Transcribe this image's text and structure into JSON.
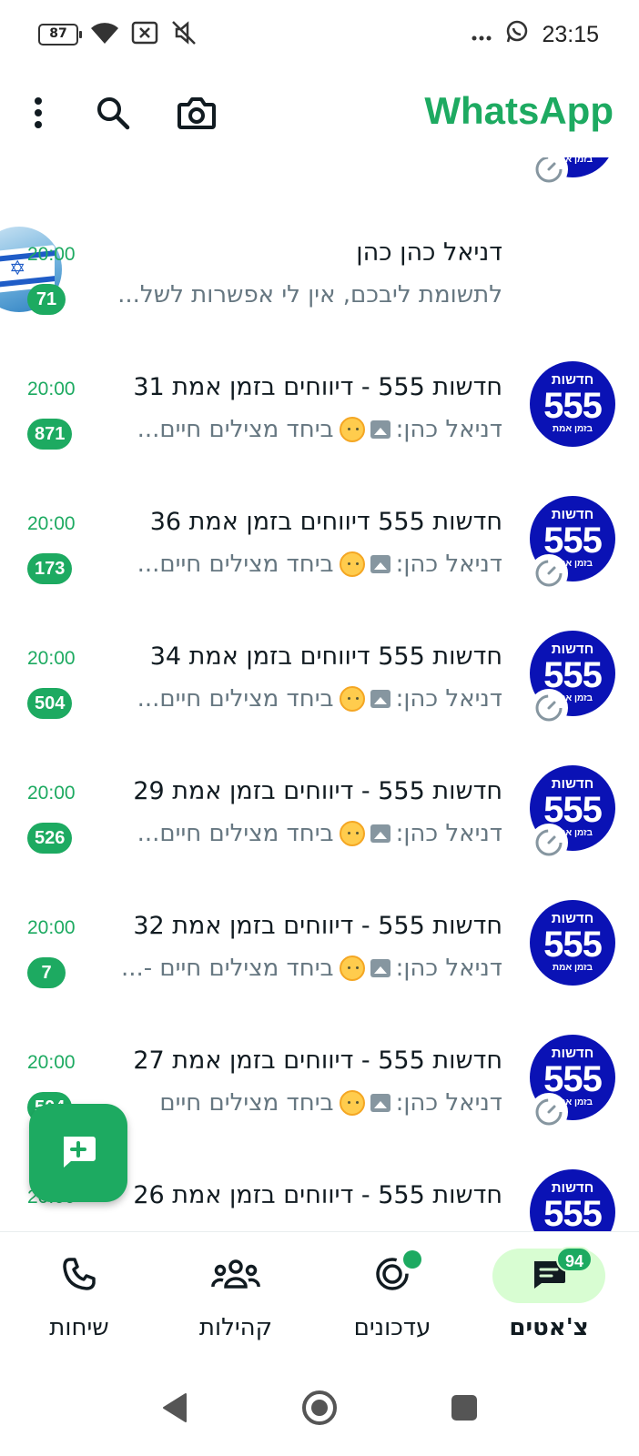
{
  "status_bar": {
    "battery": "87",
    "time": "23:15",
    "icons": [
      "battery-icon",
      "wifi-icon",
      "no-sim-icon",
      "mute-icon",
      "more-dots-icon",
      "whatsapp-notification-icon"
    ]
  },
  "app_bar": {
    "title": "WhatsApp",
    "icons": [
      "more-vert-icon",
      "search-icon",
      "camera-icon"
    ]
  },
  "chats": [
    {
      "name": "דניאל כהן כהן",
      "time": "20:00",
      "preview": "לתשומת ליבכם, אין  לי אפשרות לשל...",
      "unread": "71",
      "avatar": "flag",
      "has_image": false,
      "has_timer": false
    },
    {
      "name": "חדשות 555 - דיווחים בזמן אמת 31",
      "time": "20:00",
      "sender": "דניאל כהן:",
      "preview": "ביחד מצילים חיים...",
      "unread": "871",
      "avatar": "555",
      "has_image": true,
      "has_timer": false
    },
    {
      "name": "חדשות 555 דיווחים בזמן אמת 36",
      "time": "20:00",
      "sender": "דניאל כהן:",
      "preview": "ביחד מצילים חיים...",
      "unread": "173",
      "avatar": "555",
      "has_image": true,
      "has_timer": true
    },
    {
      "name": "חדשות 555 דיווחים בזמן אמת 34",
      "time": "20:00",
      "sender": "דניאל כהן:",
      "preview": "ביחד מצילים חיים...",
      "unread": "504",
      "avatar": "555",
      "has_image": true,
      "has_timer": true
    },
    {
      "name": "חדשות 555 - דיווחים בזמן אמת 29",
      "time": "20:00",
      "sender": "דניאל כהן:",
      "preview": "ביחד מצילים חיים...",
      "unread": "526",
      "avatar": "555",
      "has_image": true,
      "has_timer": true
    },
    {
      "name": "חדשות 555 - דיווחים בזמן אמת 32",
      "time": "20:00",
      "sender": "דניאל כהן:",
      "preview": "ביחד מצילים חיים -...",
      "unread": "7",
      "avatar": "555",
      "has_image": true,
      "has_timer": false
    },
    {
      "name": "חדשות 555 - דיווחים בזמן אמת 27",
      "time": "20:00",
      "sender": "דניאל כהן:",
      "preview": "ביחד מצילים חיים",
      "unread": "504",
      "avatar": "555",
      "has_image": true,
      "has_timer": true
    },
    {
      "name": "חדשות 555 - דיווחים בזמן אמת 26",
      "time": "20:00",
      "sender": "",
      "preview": "",
      "unread": "",
      "avatar": "555",
      "has_image": false,
      "has_timer": false
    }
  ],
  "avatar_555": {
    "top": "חדשות",
    "number": "555",
    "bottom": "בזמן אמת"
  },
  "fab": {
    "icon": "new-chat-icon"
  },
  "bottom_nav": [
    {
      "label": "צ'אטים",
      "icon": "chats-icon",
      "badge": "94",
      "active": true
    },
    {
      "label": "עדכונים",
      "icon": "updates-icon",
      "dot": true,
      "active": false
    },
    {
      "label": "קהילות",
      "icon": "communities-icon",
      "active": false
    },
    {
      "label": "שיחות",
      "icon": "calls-icon",
      "active": false
    }
  ],
  "system_nav": [
    "back-icon",
    "home-icon",
    "recents-icon"
  ],
  "colors": {
    "brand_green": "#1daa61",
    "active_tab_bg": "#d8fdd2",
    "avatar_blue": "#0a12b5",
    "secondary_text": "#667781"
  }
}
